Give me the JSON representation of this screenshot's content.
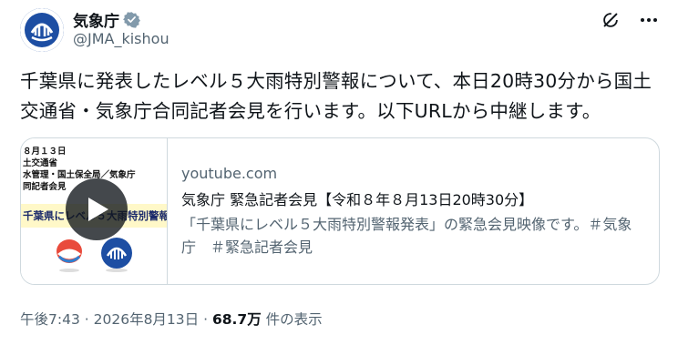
{
  "author": {
    "name": "気象庁",
    "handle": "@JMA_kishou",
    "verified": true
  },
  "icons": {
    "verified": "verified-badge-icon",
    "grok": "grok-icon",
    "more": "more-icon",
    "play": "play-icon"
  },
  "tweet": {
    "text": "千葉県に発表したレベル５大雨特別警報について、本日20時30分から国土交通省・気象庁合同記者会見を行います。以下URLから中継します。"
  },
  "card": {
    "thumbnail_lines": [
      "８月１３日",
      "土交通省",
      "水管理・国土保全局／気象庁",
      "同記者会見"
    ],
    "thumbnail_banner": "千葉県にレベル５大雨特別警報発表",
    "domain": "youtube.com",
    "title": "気象庁 緊急記者会見【令和８年８月13日20時30分】",
    "description": "「千葉県にレベル５大雨特別警報発表」の緊急会見映像です。＃気象庁　＃緊急記者会見"
  },
  "meta": {
    "time": "午後7:43",
    "date": "2026年8月13日",
    "separator": "·",
    "views": "68.7万",
    "views_suffix": "件の表示"
  },
  "colors": {
    "text": "#0f1419",
    "secondary": "#536471",
    "verified": "#829aab",
    "border": "#cfd9de",
    "jma_blue": "#1d4ea3"
  }
}
